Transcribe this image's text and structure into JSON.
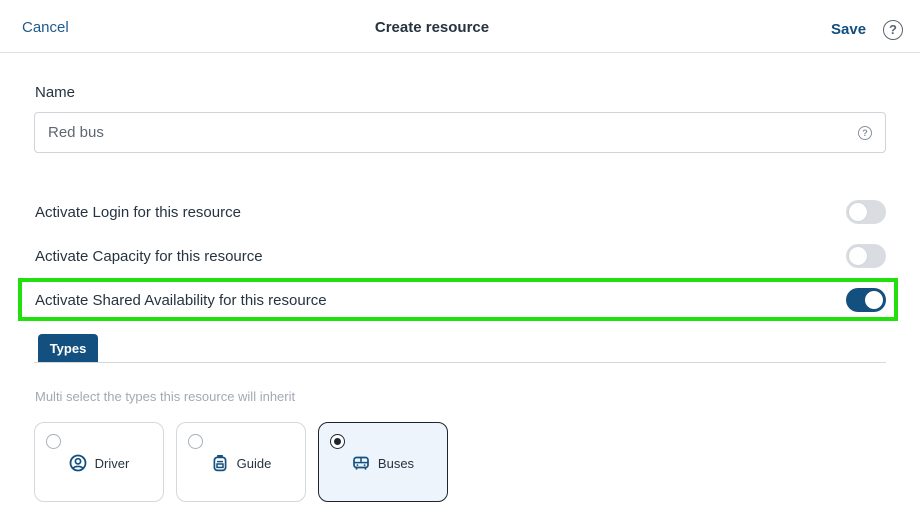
{
  "header": {
    "cancel_label": "Cancel",
    "title": "Create resource",
    "save_label": "Save",
    "help_glyph": "?"
  },
  "name_field": {
    "label": "Name",
    "value": "Red bus",
    "help_glyph": "?"
  },
  "toggles": [
    {
      "label": "Activate Login for this resource",
      "on": false
    },
    {
      "label": "Activate Capacity for this resource",
      "on": false
    },
    {
      "label": "Activate Shared Availability for this resource",
      "on": true
    }
  ],
  "highlight_color": "#22e00e",
  "tabs": [
    {
      "label": "Types",
      "active": true
    }
  ],
  "types_hint": "Multi select the types this resource will inherit",
  "type_cards": [
    {
      "label": "Driver",
      "icon": "user-circle-icon",
      "selected": false
    },
    {
      "label": "Guide",
      "icon": "backpack-icon",
      "selected": false
    },
    {
      "label": "Buses",
      "icon": "bus-icon",
      "selected": true
    }
  ],
  "colors": {
    "primary": "#14507f",
    "link": "#1e5a8c",
    "toggle_off": "#d9dde2"
  }
}
